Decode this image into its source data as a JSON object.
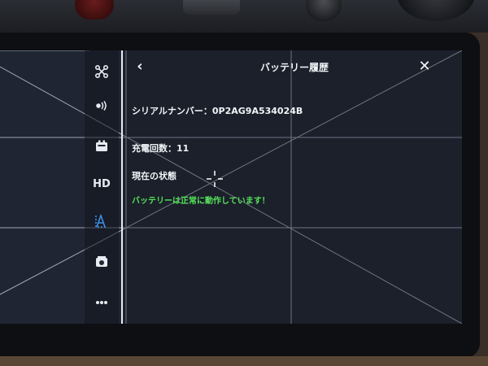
{
  "panel": {
    "title": "バッテリー履歴",
    "back_icon": "chevron-left-icon",
    "close_icon": "close-icon"
  },
  "battery": {
    "serial_label": "シリアルナンバー：",
    "serial_value": "0P2AG9A534024B",
    "charge_label": "充電回数：",
    "charge_count": "11",
    "state_label": "現在の状態",
    "status_message": "バッテリーは正常に動作しています！"
  },
  "sidebar": {
    "items": [
      {
        "icon": "drone-icon"
      },
      {
        "icon": "signal-icon"
      },
      {
        "icon": "battery-icon"
      },
      {
        "label": "HD",
        "icon": "hd-video-icon"
      },
      {
        "icon": "language-icon"
      },
      {
        "icon": "camera-icon"
      },
      {
        "icon": "more-icon"
      }
    ]
  },
  "colors": {
    "screen_bg": "#1f2532",
    "grid_line": "#c9d3e0",
    "status_ok": "#57e35a",
    "accent_blue": "#3a8ee6"
  }
}
